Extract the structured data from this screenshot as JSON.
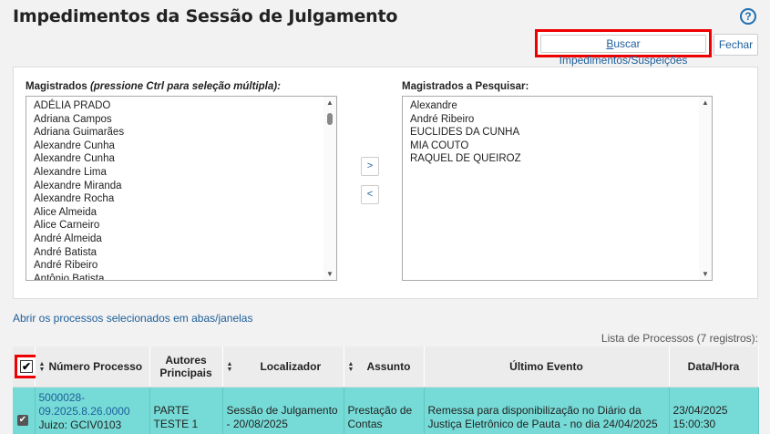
{
  "title": "Impedimentos da Sessão de Julgamento",
  "help_icon": "help-circle-icon",
  "buttons": {
    "buscar_underline": "B",
    "buscar_rest": "uscar Impedimentos/Suspeições",
    "fechar": "Fechar"
  },
  "magistrados": {
    "label_bold": "Magistrados ",
    "label_italic": "(pressione Ctrl para seleção múltipla):",
    "items": [
      "ADÉLIA PRADO",
      "Adriana Campos",
      "Adriana Guimarães",
      "Alexandre Cunha",
      "Alexandre Cunha",
      "Alexandre Lima",
      "Alexandre Miranda",
      "Alexandre Rocha",
      "Alice Almeida",
      "Alice Carneiro",
      "André Almeida",
      "André Batista",
      "André Ribeiro",
      "Antônio Batista"
    ]
  },
  "pesquisar": {
    "label": "Magistrados a Pesquisar:",
    "items": [
      "Alexandre",
      "André Ribeiro",
      "EUCLIDES DA CUNHA",
      "MIA COUTO",
      "RAQUEL DE QUEIROZ"
    ]
  },
  "move_buttons": {
    "add": ">",
    "remove": "<"
  },
  "link_open": "Abrir os processos selecionados em abas/janelas",
  "records": "Lista de Processos (7 registros):",
  "table": {
    "headers": {
      "numero": "Número Processo",
      "autores": "Autores Principais",
      "localizador": "Localizador",
      "assunto": "Assunto",
      "evento": "Último Evento",
      "data": "Data/Hora"
    },
    "row": {
      "numero_link": "5000028-09.2025.8.26.0000",
      "juizo": "Juizo: GCIV0103",
      "autores": "PARTE TESTE 1",
      "localizador": "Sessão de Julgamento - 20/08/2025",
      "assunto": "Prestação de Contas",
      "evento": "Remessa para disponibilização no Diário da Justiça Eletrônico de Pauta - no dia 24/04/2025",
      "data": "23/04/2025 15:00:30"
    }
  },
  "colors": {
    "highlight": "#e00000",
    "row_bg": "#76dbd7",
    "link": "#1d5e9a"
  }
}
